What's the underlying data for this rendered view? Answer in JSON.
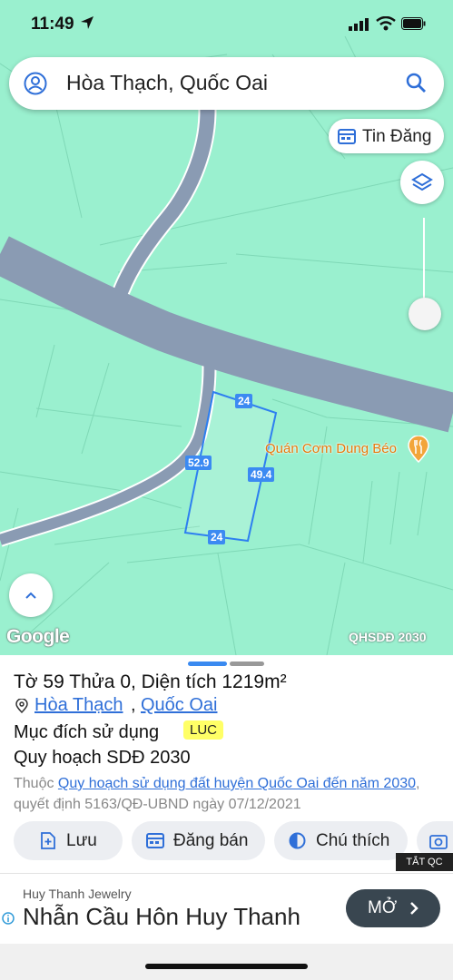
{
  "status": {
    "time": "11:49"
  },
  "search": {
    "title": "Hòa Thạch, Quốc Oai"
  },
  "tin_dang": {
    "label": "Tin Đăng"
  },
  "map": {
    "poi_name": "Quán Cơm Dung Béo",
    "edge_labels": {
      "top": "24",
      "left": "52.9",
      "right": "49.4",
      "bottom": "24"
    },
    "google": "Google",
    "overlay": "QHSDĐ 2030",
    "colors": {
      "land": "#9af0cf",
      "road": "#8a9bb3",
      "parcel": "#2d7ff0"
    }
  },
  "sheet": {
    "title": "Tờ 59 Thửa 0, Diện tích 1219m²",
    "commune": "Hòa Thạch",
    "separator": ",",
    "district": "Quốc Oai",
    "purpose_label": "Mục đích sử dụng",
    "purpose_code": "LUC",
    "plan_label": "Quy hoạch SDĐ 2030",
    "note_prefix": "Thuộc ",
    "note_link": "Quy hoạch sử dụng đất huyện Quốc Oai đến năm 2030",
    "note_suffix": ", quyết định 5163/QĐ-UBND ngày 07/12/2021",
    "actions": {
      "save": "Lưu",
      "post": "Đăng bán",
      "legend": "Chú thích"
    }
  },
  "ad": {
    "close": "TẮT QC",
    "brand": "Huy Thanh Jewelry",
    "headline": "Nhẫn Cầu Hôn Huy Thanh",
    "open": "MỞ"
  }
}
